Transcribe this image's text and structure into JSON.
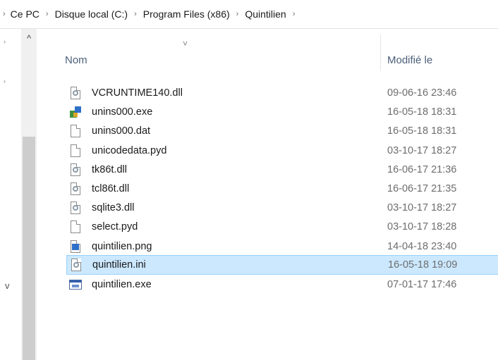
{
  "breadcrumb": {
    "items": [
      "Ce PC",
      "Disque local (C:)",
      "Program Files (x86)",
      "Quintilien"
    ],
    "separator": "›"
  },
  "header": {
    "name_label": "Nom",
    "modified_label": "Modifié le",
    "sort_indicator": "˅"
  },
  "nav": {
    "up_arrow": "^",
    "v_mark": "v"
  },
  "files": [
    {
      "name": "VCRUNTIME140.dll",
      "date": "09-06-16 23:46",
      "icon": "dll-icon"
    },
    {
      "name": "unins000.exe",
      "date": "16-05-18 18:31",
      "icon": "setup-icon"
    },
    {
      "name": "unins000.dat",
      "date": "16-05-18 18:31",
      "icon": "file-icon"
    },
    {
      "name": "unicodedata.pyd",
      "date": "03-10-17 18:27",
      "icon": "file-icon"
    },
    {
      "name": "tk86t.dll",
      "date": "16-06-17 21:36",
      "icon": "dll-icon"
    },
    {
      "name": "tcl86t.dll",
      "date": "16-06-17 21:35",
      "icon": "dll-icon"
    },
    {
      "name": "sqlite3.dll",
      "date": "03-10-17 18:27",
      "icon": "dll-icon"
    },
    {
      "name": "select.pyd",
      "date": "03-10-17 18:28",
      "icon": "file-icon"
    },
    {
      "name": "quintilien.png",
      "date": "14-04-18 23:40",
      "icon": "image-icon"
    },
    {
      "name": "quintilien.ini",
      "date": "16-05-18 19:09",
      "icon": "settings-file-icon",
      "selected": true
    },
    {
      "name": "quintilien.exe",
      "date": "07-01-17 17:46",
      "icon": "exe-icon"
    }
  ],
  "colors": {
    "selection_bg": "#cce8ff",
    "selection_border": "#99d1ff",
    "header_text": "#4c607a"
  }
}
